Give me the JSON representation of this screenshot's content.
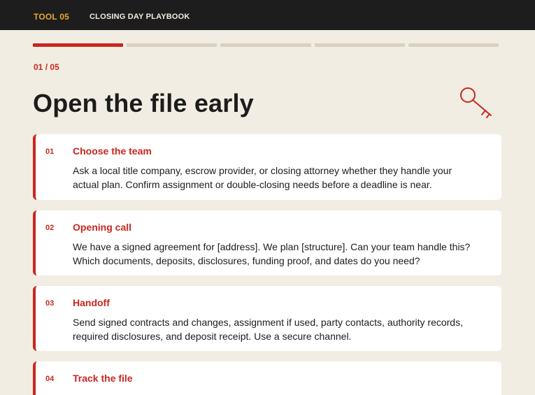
{
  "header": {
    "tool_tag": "TOOL 05",
    "title": "CLOSING DAY PLAYBOOK"
  },
  "progress": {
    "total_steps": 5,
    "current_step": 1
  },
  "step": {
    "current": "01",
    "separator": "/",
    "total": "05"
  },
  "page_title": "Open the file early",
  "icon": "key-icon",
  "colors": {
    "accent": "#c8271f",
    "tag": "#e8a631",
    "topbar": "#1c1d1c",
    "background": "#f2ede3",
    "progress_inactive": "#d9d0c1"
  },
  "cards": [
    {
      "number": "01",
      "title": "Choose the team",
      "body": "Ask a local title company, escrow provider, or closing attorney whether they handle your actual plan. Confirm assignment or double-closing needs before a deadline is near."
    },
    {
      "number": "02",
      "title": "Opening call",
      "body": "We have a signed agreement for [address]. We plan [structure]. Can your team handle this? Which documents, deposits, disclosures, funding proof, and dates do you need?"
    },
    {
      "number": "03",
      "title": "Handoff",
      "body": "Send signed contracts and changes, assignment if used, party contacts, authority records, required disclosures, and deposit receipt. Use a secure channel."
    },
    {
      "number": "04",
      "title": "Track the file",
      "body": ""
    }
  ]
}
